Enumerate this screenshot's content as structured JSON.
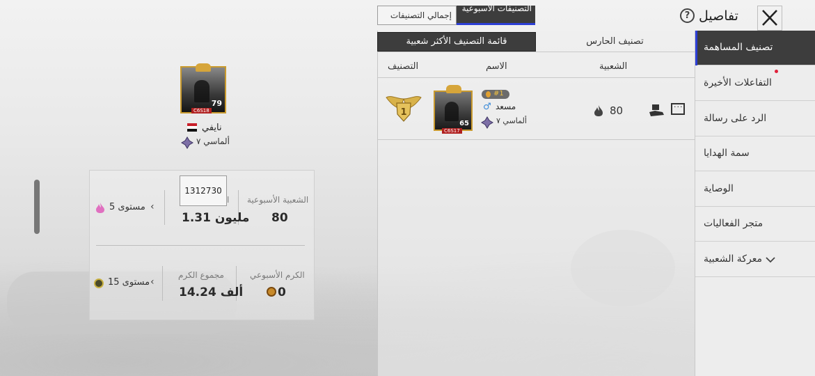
{
  "header": {
    "title": "تفاصيل",
    "help_icon": "question-circle-icon",
    "close_icon": "close-x-icon"
  },
  "top_tabs": {
    "weekly": "التصنيفات الأسبوعية",
    "total": "إجمالي التصنيفات"
  },
  "sub_tabs": {
    "guardian": "تصنيف الحارس",
    "popular": "قائمة التصنيف الأكثر شعبية"
  },
  "table_headers": {
    "popularity": "الشعبية",
    "name": "الاسم",
    "rank": "التصنيف"
  },
  "entry": {
    "rank_badge": "#1",
    "name": "مسعد",
    "gender_icon": "male-icon",
    "tier": "ألماسي ٧",
    "level": "65",
    "frame_tag": "C6S17",
    "popularity": "80"
  },
  "sidebar": {
    "items": [
      {
        "label": "تصنيف المساهمة",
        "active": true
      },
      {
        "label": "التفاعلات الأخيرة"
      },
      {
        "label": "الرد على رسالة"
      },
      {
        "label": "سمة الهدايا"
      },
      {
        "label": "الوصاية"
      },
      {
        "label": "متجر الفعاليات"
      },
      {
        "label": "معركة الشعبية"
      }
    ]
  },
  "profile": {
    "name": "نايفي",
    "level": "79",
    "frame_tag": "C6S18",
    "tier": "ألماسي ٧"
  },
  "stats": {
    "weekly_popularity_label": "الشعبية الأسبوعية",
    "weekly_popularity": "80",
    "total_popularity_label": "ا",
    "total_popularity": "1.31 مليون",
    "tooltip_value": "1312730",
    "popularity_level": "مستوى 5",
    "weekly_generosity_label": "الكرم الأسبوعي",
    "weekly_generosity": "0",
    "total_generosity_label": "مجموع الكرم",
    "total_generosity": "14.24 ألف",
    "generosity_level": "مستوى 15"
  },
  "colors": {
    "accent_blue": "#2d3fd6",
    "dark": "#3d3d3d",
    "notify_red": "#e0203a",
    "gold": "#c99a2e"
  }
}
